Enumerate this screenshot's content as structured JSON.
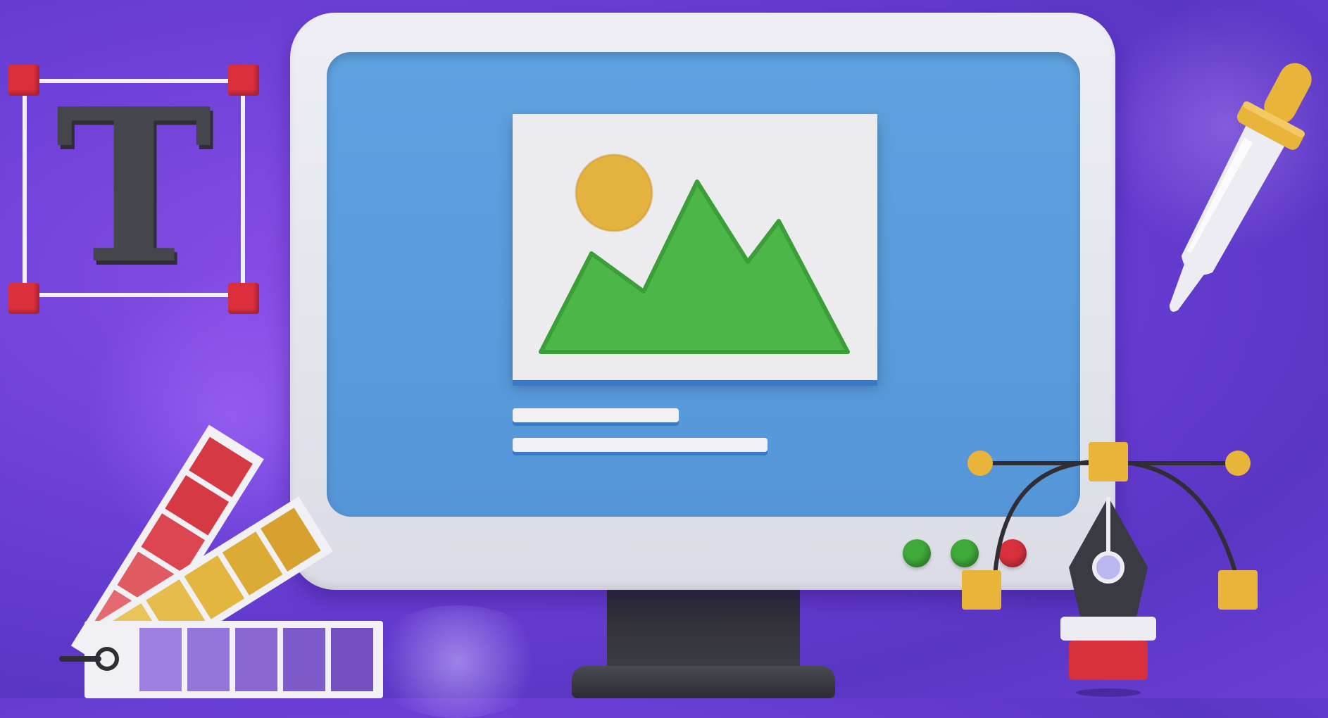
{
  "scene": {
    "description_label": "",
    "colors": {
      "background": "#6b3fd6",
      "screen": "#5fa2e0",
      "bezel": "#e6e6ee",
      "mountain": "#4cb648",
      "sun": "#e3b23f",
      "handle": "#dc2f3c",
      "anchor": "#e9b43a"
    },
    "text_tool": {
      "glyph": "T",
      "icon": "text-tool-icon"
    },
    "monitor": {
      "icon": "monitor-icon",
      "buttons": [
        "green",
        "green",
        "red"
      ]
    },
    "image_card": {
      "icon": "image-placeholder-icon"
    },
    "dropper": {
      "icon": "eyedropper-icon"
    },
    "palette": {
      "icon": "color-swatch-icon"
    },
    "pen": {
      "icon": "pen-tool-icon"
    }
  }
}
